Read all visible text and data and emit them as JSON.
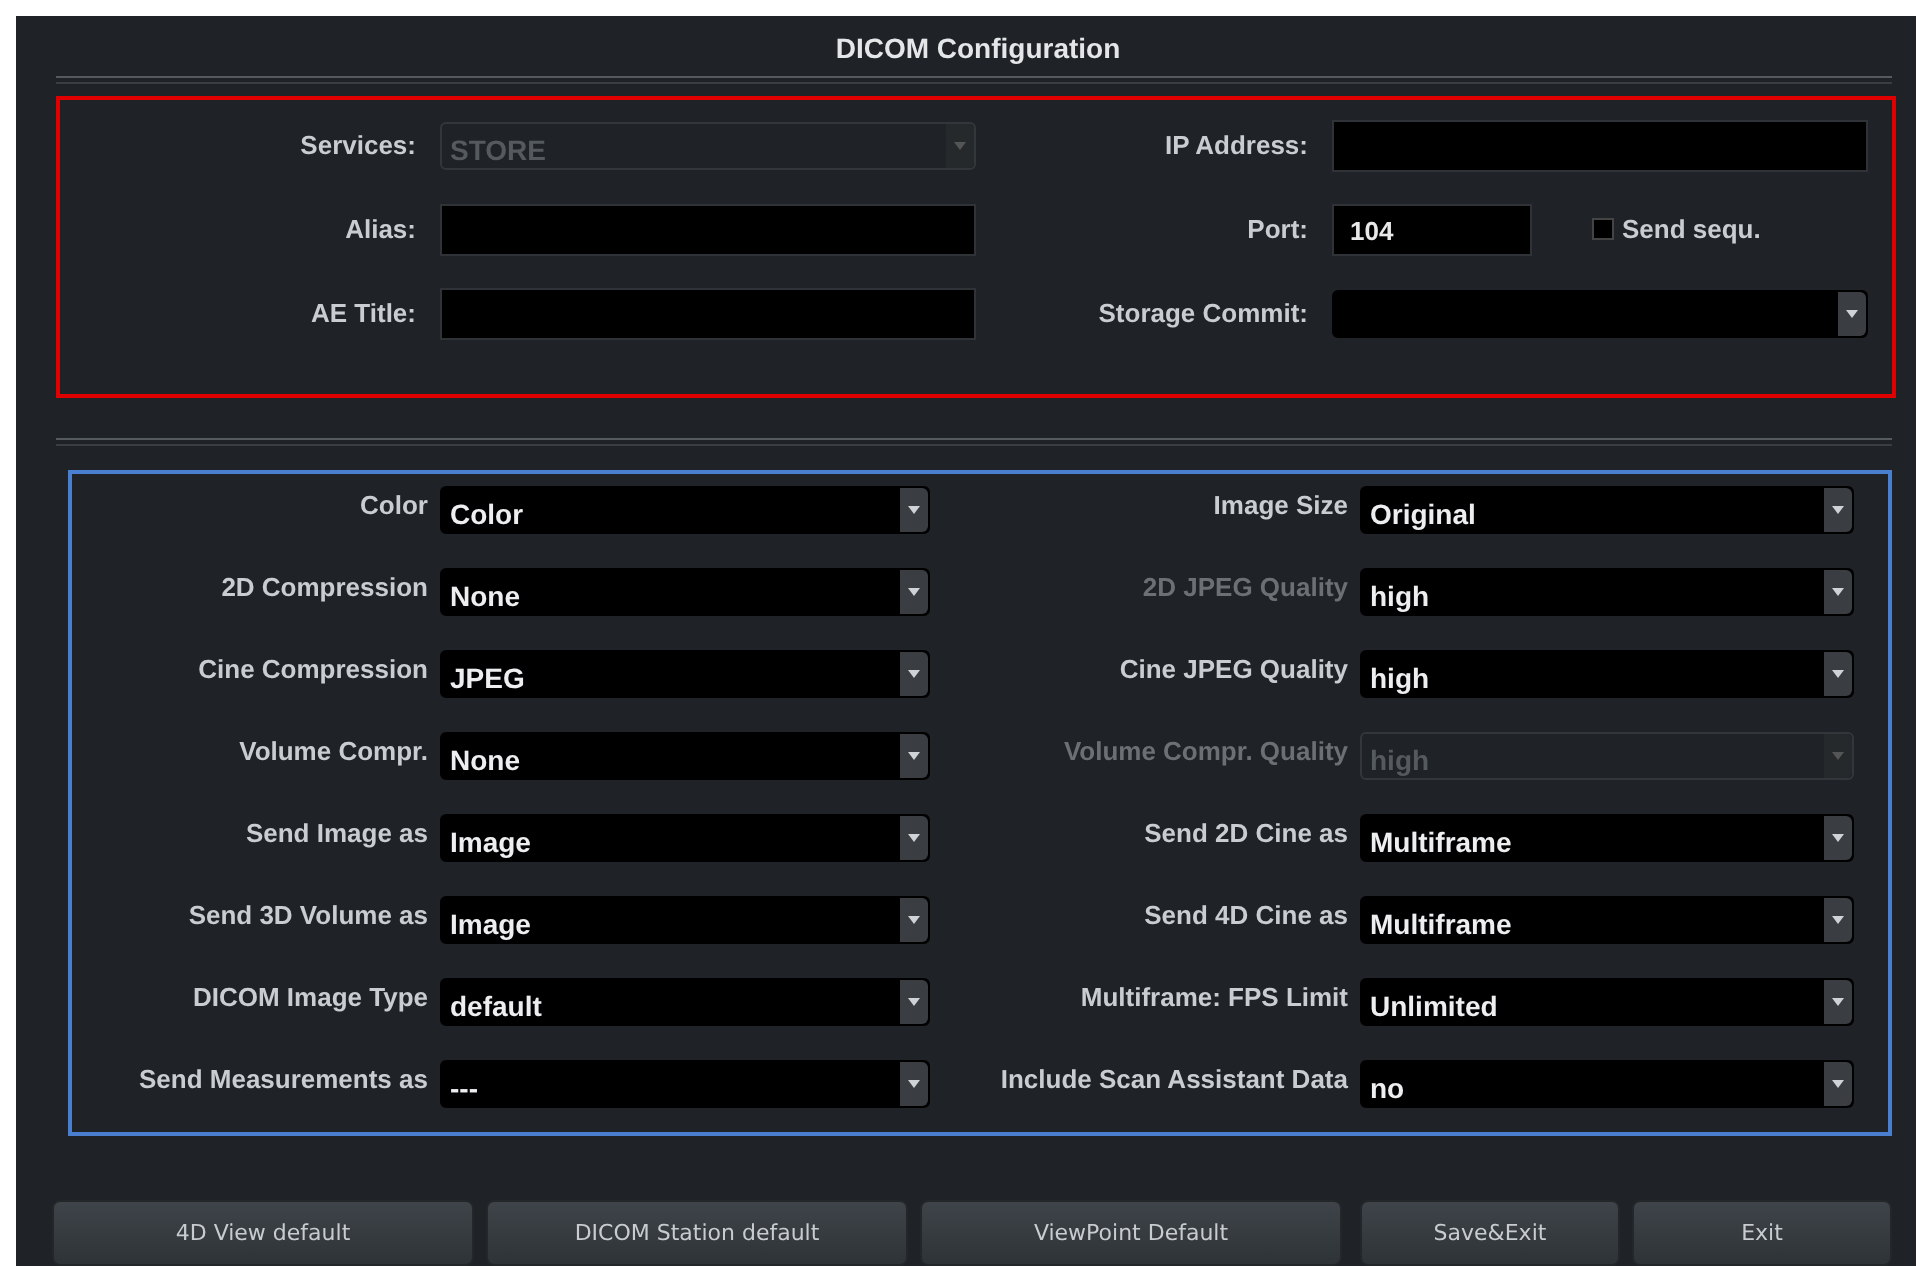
{
  "window": {
    "title": "DICOM Configuration"
  },
  "connection": {
    "left": [
      {
        "kind": "select",
        "label": "Services:",
        "value": "STORE",
        "disabled": true
      },
      {
        "kind": "input",
        "label": "Alias:"
      },
      {
        "kind": "input",
        "label": "AE Title:"
      }
    ],
    "right": [
      {
        "kind": "input",
        "label": "IP Address:"
      },
      {
        "kind": "port",
        "label": "Port:",
        "value": "104",
        "checkbox": {
          "label": "Send sequ.",
          "checked": false
        }
      },
      {
        "kind": "select",
        "label": "Storage Commit:",
        "disabled": false
      }
    ]
  },
  "settings": {
    "left": [
      {
        "label": "Color",
        "value": "Color",
        "disabled": false,
        "label_dimmed": false
      },
      {
        "label": "2D Compression",
        "value": "None",
        "disabled": false,
        "label_dimmed": false
      },
      {
        "label": "Cine Compression",
        "value": "JPEG",
        "disabled": false,
        "label_dimmed": false
      },
      {
        "label": "Volume Compr.",
        "value": "None",
        "disabled": false,
        "label_dimmed": false
      },
      {
        "label": "Send Image as",
        "value": "Image",
        "disabled": false,
        "label_dimmed": false
      },
      {
        "label": "Send 3D Volume as",
        "value": "Image",
        "disabled": false,
        "label_dimmed": false
      },
      {
        "label": "DICOM Image Type",
        "value": "default",
        "disabled": false,
        "label_dimmed": false
      },
      {
        "label": "Send Measurements as",
        "value": "---",
        "disabled": false,
        "label_dimmed": false
      }
    ],
    "right": [
      {
        "label": "Image Size",
        "value": "Original",
        "disabled": false,
        "label_dimmed": false
      },
      {
        "label": "2D JPEG Quality",
        "value": "high",
        "disabled": false,
        "label_dimmed": true
      },
      {
        "label": "Cine JPEG Quality",
        "value": "high",
        "disabled": false,
        "label_dimmed": false
      },
      {
        "label": "Volume Compr. Quality",
        "value": "high",
        "disabled": true,
        "label_dimmed": true
      },
      {
        "label": "Send 2D Cine as",
        "value": "Multiframe",
        "disabled": false,
        "label_dimmed": false
      },
      {
        "label": "Send 4D Cine as",
        "value": "Multiframe",
        "disabled": false,
        "label_dimmed": false
      },
      {
        "label": "Multiframe: FPS Limit",
        "value": "Unlimited",
        "disabled": false,
        "label_dimmed": false
      },
      {
        "label": "Include Scan Assistant Data",
        "value": "no",
        "disabled": false,
        "label_dimmed": false
      }
    ]
  },
  "buttons_left": [
    "4D View default",
    "DICOM Station default",
    "ViewPoint Default"
  ],
  "buttons_right": [
    "Save&Exit",
    "Exit"
  ]
}
